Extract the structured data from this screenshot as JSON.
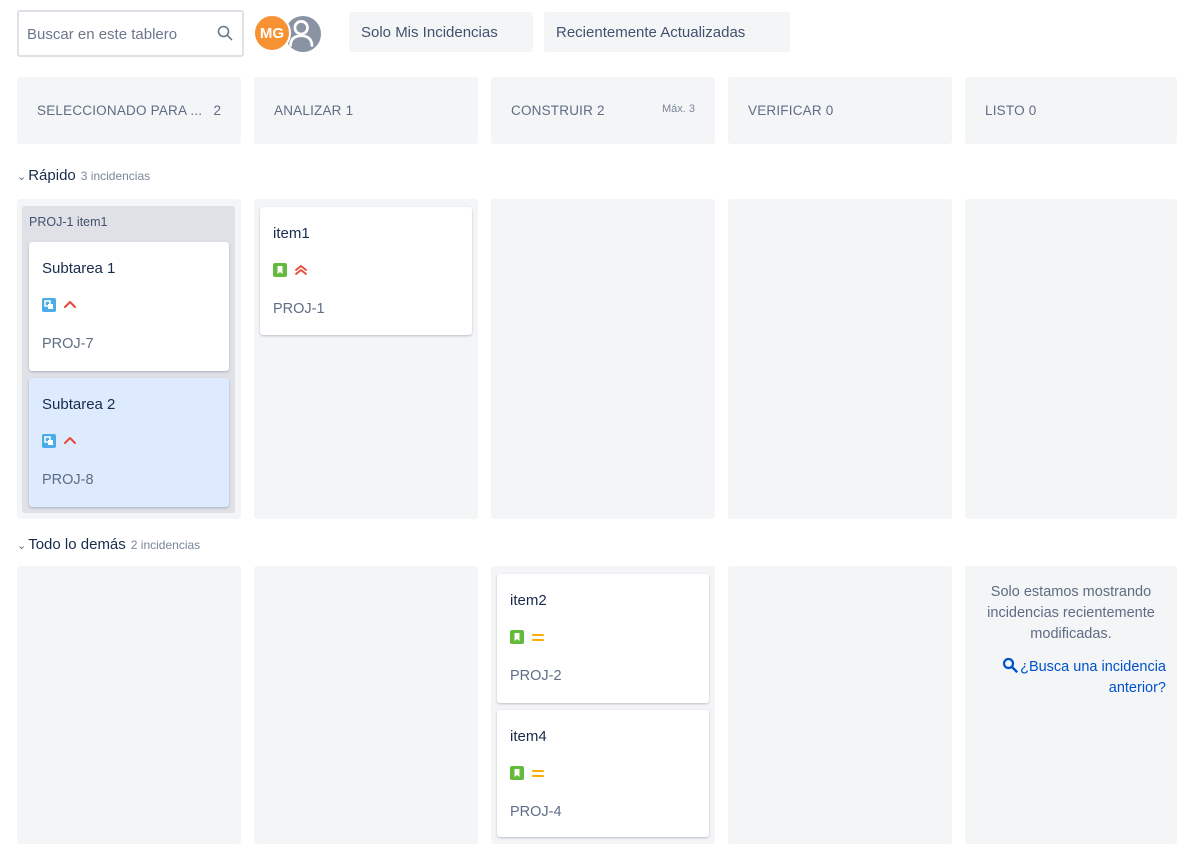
{
  "search": {
    "placeholder": "Buscar en este tablero"
  },
  "avatars": {
    "user_initials": "MG"
  },
  "quick_filters": [
    {
      "label": "Solo Mis Incidencias"
    },
    {
      "label": "Recientemente Actualizadas"
    }
  ],
  "columns": [
    {
      "title": "SELECCIONADO PARA ...",
      "count": "2",
      "max": ""
    },
    {
      "title": "ANALIZAR",
      "count": "1",
      "max": ""
    },
    {
      "title": "CONSTRUIR",
      "count": "2",
      "max": "Máx. 3"
    },
    {
      "title": "VERIFICAR",
      "count": "0",
      "max": ""
    },
    {
      "title": "LISTO",
      "count": "0",
      "max": ""
    }
  ],
  "swimlanes": [
    {
      "name": "Rápido",
      "sub": "3 incidencias"
    },
    {
      "name": "Todo lo demás",
      "sub": "2 incidencias"
    }
  ],
  "parent": {
    "label": "PROJ-1 item1"
  },
  "cards": [
    {
      "title": "Subtarea 1",
      "key": "PROJ-7",
      "type": "subtask-icon",
      "priority": "high-priority-icon"
    },
    {
      "title": "Subtarea 2",
      "key": "PROJ-8",
      "type": "subtask-icon",
      "priority": "high-priority-icon"
    },
    {
      "title": "item1",
      "key": "PROJ-1",
      "type": "story-icon",
      "priority": "highest-priority-icon"
    },
    {
      "title": "item2",
      "key": "PROJ-2",
      "type": "story-icon",
      "priority": "medium-priority-icon"
    },
    {
      "title": "item4",
      "key": "PROJ-4",
      "type": "story-icon",
      "priority": "medium-priority-icon"
    }
  ],
  "message": {
    "text": "Solo estamos mostrando incidencias recientemente modificadas.",
    "link": "¿Busca una incidencia anterior?"
  },
  "colors": {
    "avatar": "#f79232",
    "story": "#63ba3c",
    "subtask": "#4bade8",
    "priority_high": "#e5493a",
    "priority_medium": "#ffab00",
    "link": "#0052cc",
    "selected_card": "#deebff"
  }
}
